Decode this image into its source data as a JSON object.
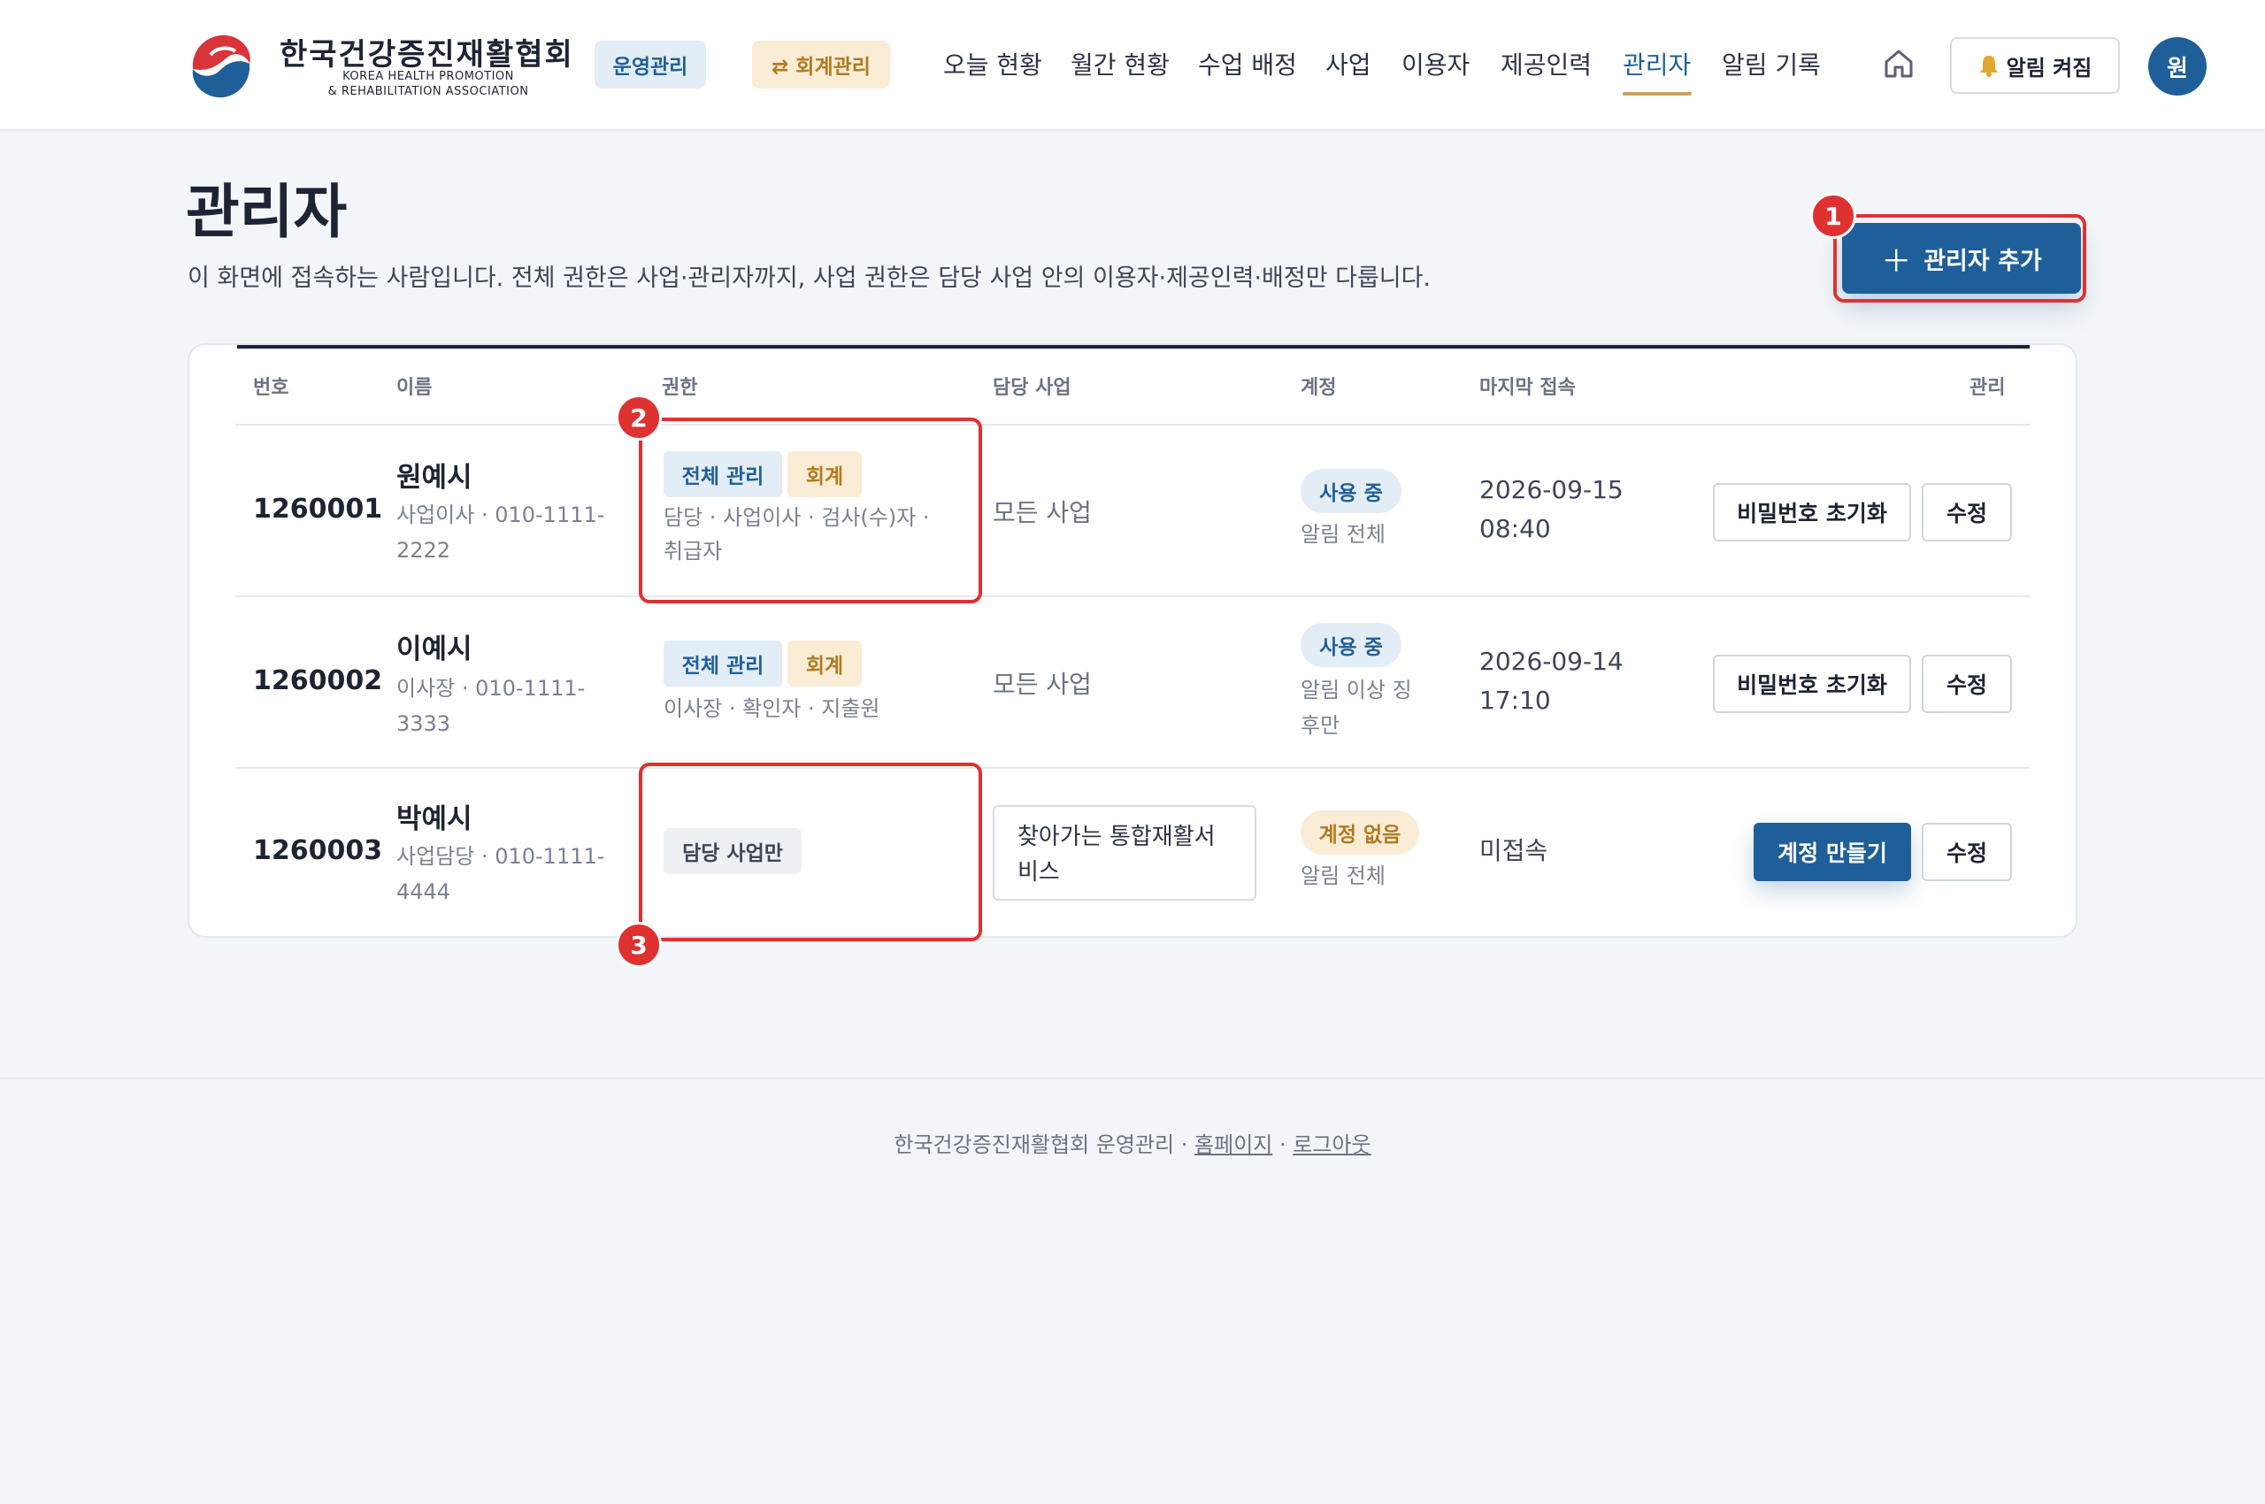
{
  "brand": {
    "name_ko": "한국건강증진재활협회",
    "name_en_line1": "KOREA HEALTH PROMOTION",
    "name_en_line2": "& REHABILITATION ASSOCIATION",
    "logo_icon": "taegeuk-logo",
    "color_primary": "#1f5f99",
    "color_accent": "#c9a25a"
  },
  "header": {
    "mode_ops": "운영관리",
    "mode_acc": "⇄ 회계관리",
    "nav": [
      {
        "label": "오늘 현황"
      },
      {
        "label": "월간 현황"
      },
      {
        "label": "수업 배정"
      },
      {
        "label": "사업"
      },
      {
        "label": "이용자"
      },
      {
        "label": "제공인력"
      },
      {
        "label": "관리자",
        "active": true
      },
      {
        "label": "알림 기록"
      }
    ],
    "home_icon": "home-icon",
    "alarm_icon": "bell-icon",
    "alarm_label": "알림 켜짐",
    "avatar_initial": "원"
  },
  "page": {
    "title": "관리자",
    "description": "이 화면에 접속하는 사람입니다. 전체 권한은 사업·관리자까지, 사업 권한은 담당 사업 안의 이용자·제공인력·배정만 다룹니다.",
    "add_button_icon": "plus-icon",
    "add_button_label": "관리자 추가"
  },
  "table": {
    "headers": {
      "id": "번호",
      "name": "이름",
      "permission": "권한",
      "business": "담당 사업",
      "account": "계정",
      "last_login": "마지막 접속",
      "manage": "관리"
    },
    "rows": [
      {
        "id": "1260001",
        "name": "원예시",
        "sub": "사업이사 · 010-1111-2222",
        "tags": [
          "전체 관리",
          "회계"
        ],
        "roles": "담당 · 사업이사 · 검사(수)자 · 취급자",
        "business": "모든 사업",
        "status": "사용 중",
        "alarm": "알림 전체",
        "last_login_line1": "2026-09-15",
        "last_login_line2": "08:40",
        "action_primary": "비밀번호 초기화",
        "action_edit": "수정"
      },
      {
        "id": "1260002",
        "name": "이예시",
        "sub": "이사장 · 010-1111-3333",
        "tags": [
          "전체 관리",
          "회계"
        ],
        "roles": "이사장 · 확인자 · 지출원",
        "business": "모든 사업",
        "status": "사용 중",
        "alarm": "알림 이상 징후만",
        "last_login_line1": "2026-09-14",
        "last_login_line2": "17:10",
        "action_primary": "비밀번호 초기화",
        "action_edit": "수정"
      },
      {
        "id": "1260003",
        "name": "박예시",
        "sub": "사업담당 · 010-1111-4444",
        "tags": [
          "담당 사업만"
        ],
        "roles": "",
        "business": "찾아가는 통합재활서비스",
        "status": "계정 없음",
        "alarm": "알림 전체",
        "last_login_line1": "미접속",
        "last_login_line2": "",
        "action_primary": "계정 만들기",
        "action_edit": "수정"
      }
    ]
  },
  "annotations": [
    "1",
    "2",
    "3"
  ],
  "annotation_color": "#e03131",
  "footer": {
    "text": "한국건강증진재활협회 운영관리 ·",
    "link_home": "홈페이지",
    "separator": "·",
    "link_logout": "로그아웃"
  }
}
